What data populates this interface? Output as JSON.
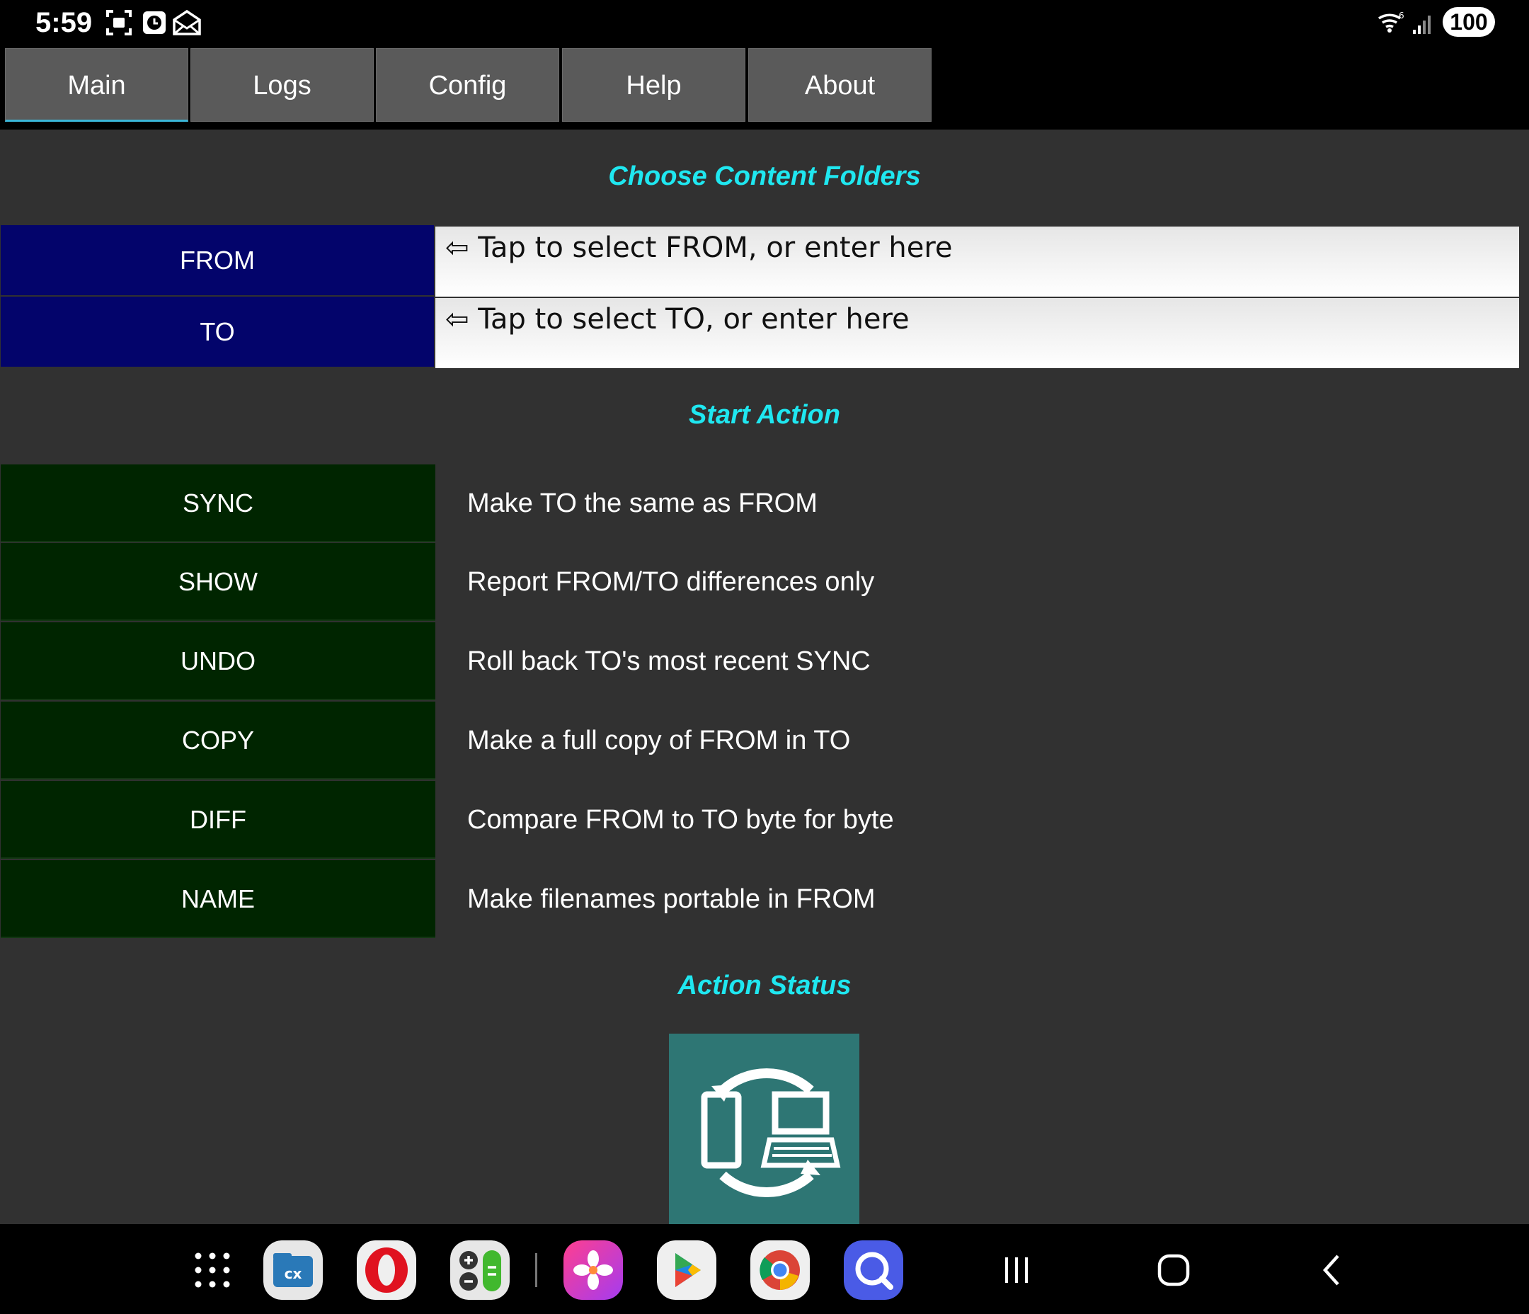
{
  "status_bar": {
    "time": "5:59",
    "battery": "100",
    "icons": [
      "screenshot-icon",
      "clock-app-icon",
      "mail-icon",
      "wifi-icon",
      "signal-icon"
    ]
  },
  "tabs": [
    {
      "label": "Main",
      "active": true
    },
    {
      "label": "Logs",
      "active": false
    },
    {
      "label": "Config",
      "active": false
    },
    {
      "label": "Help",
      "active": false
    },
    {
      "label": "About",
      "active": false
    }
  ],
  "folders": {
    "heading": "Choose Content Folders",
    "from_label": "FROM",
    "from_placeholder": "⇦ Tap to select FROM, or enter here",
    "from_value": "",
    "to_label": "TO",
    "to_placeholder": "⇦ Tap to select TO, or enter here",
    "to_value": ""
  },
  "actions": {
    "heading": "Start Action",
    "items": [
      {
        "label": "SYNC",
        "description": "Make TO the same as FROM"
      },
      {
        "label": "SHOW",
        "description": "Report FROM/TO differences only"
      },
      {
        "label": "UNDO",
        "description": "Roll back TO's most recent SYNC"
      },
      {
        "label": "COPY",
        "description": "Make a full copy of FROM in TO"
      },
      {
        "label": "DIFF",
        "description": "Compare FROM to TO byte for byte"
      },
      {
        "label": "NAME",
        "description": "Make filenames portable in FROM"
      }
    ]
  },
  "status": {
    "heading": "Action Status",
    "image_icon": "sync-devices-icon"
  },
  "dock_icons": [
    "app-drawer-icon",
    "file-manager-icon",
    "opera-icon",
    "calculator-icon",
    "gallery-icon",
    "play-store-icon",
    "chrome-icon",
    "search-app-icon"
  ],
  "nav_icons": [
    "recents-icon",
    "home-icon",
    "back-icon"
  ],
  "colors": {
    "heading": "#1fe7f0",
    "folder_button": "#03046b",
    "action_button": "#002500",
    "background": "#313131",
    "status_image": "#2e7674"
  }
}
